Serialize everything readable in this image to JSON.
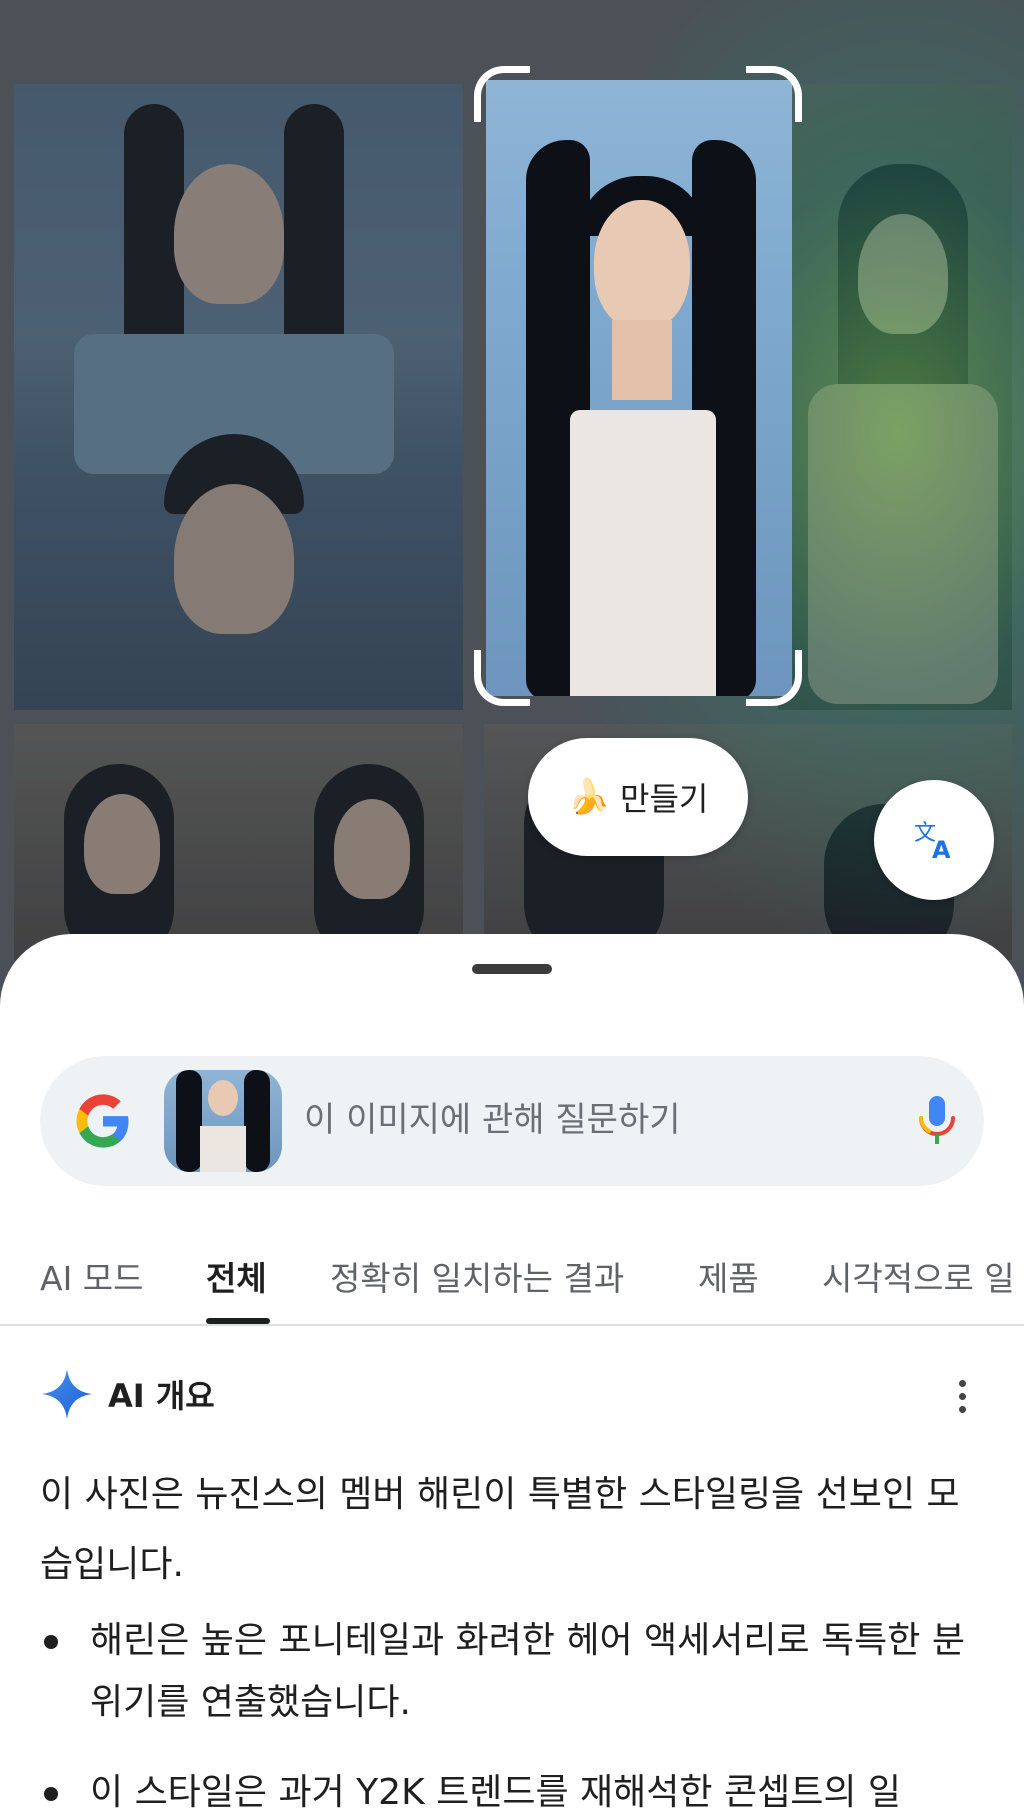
{
  "create_chip": {
    "emoji": "🍌",
    "label": "만들기"
  },
  "search": {
    "placeholder": "이 이미지에 관해 질문하기"
  },
  "tabs": [
    {
      "label": "AI 모드"
    },
    {
      "label": "전체",
      "active": true
    },
    {
      "label": "정확히 일치하는 결과"
    },
    {
      "label": "제품"
    },
    {
      "label": "시각적으로 일"
    }
  ],
  "ai_overview": {
    "title": "AI 개요",
    "summary": "이 사진은 뉴진스의 멤버 해린이 특별한 스타일링을 선보인 모습입니다.",
    "bullets": [
      "해린은 높은 포니테일과 화려한 헤어 액세서리로 독특한 분위기를 연출했습니다.",
      "이 스타일은 과거 Y2K 트렌드를 재해석한 콘셉트의 일"
    ]
  },
  "colors": {
    "accent_blue": "#1a73e8",
    "ai_spark": "#4285f4",
    "sheet_bg": "#ffffff",
    "search_bg": "#eff2f5"
  },
  "icons": [
    "google-g-icon",
    "mic-icon",
    "translate-icon",
    "sparkle-icon",
    "more-vert-icon"
  ]
}
